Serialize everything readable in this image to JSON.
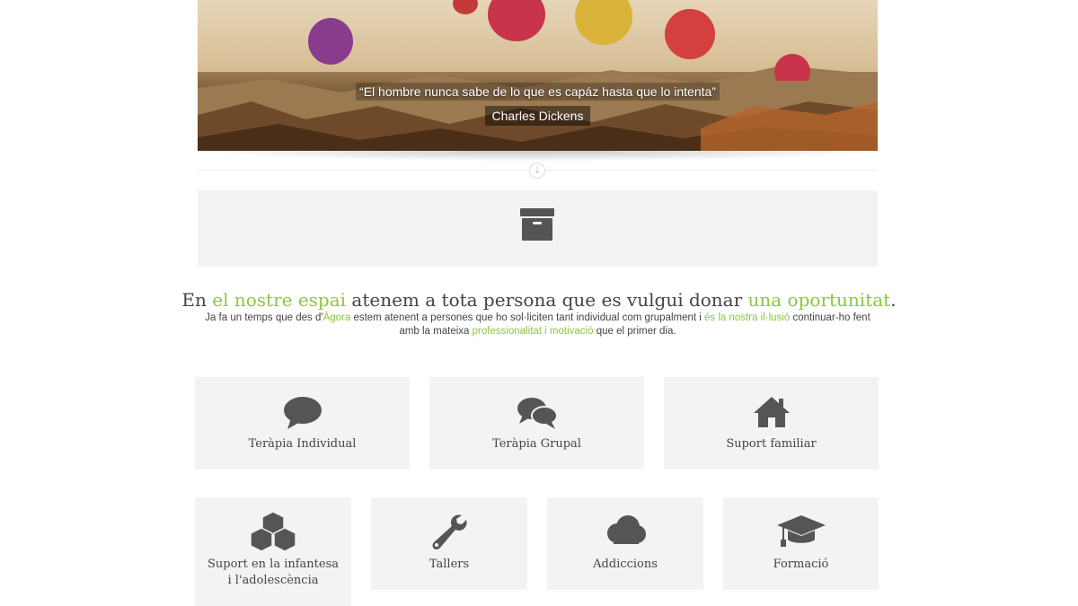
{
  "hero": {
    "quote": "“El hombre nunca sabe de lo que es capáz hasta que lo intenta”",
    "author": "Charles Dickens"
  },
  "intro": {
    "title_part1": "En ",
    "title_highlight1": "el nostre espai",
    "title_part2": " atenem a tota persona que es vulgui donar ",
    "title_highlight2": "una oportunitat",
    "title_part3": ".",
    "text_part1": "Ja fa un temps que des d'",
    "text_highlight1": "Àgora",
    "text_part2": " estem atenent a persones que ho sol·liciten tant individual com grupalment i ",
    "text_highlight2": "és la nostra il·lusió",
    "text_part3": " continuar-ho fent amb la mateixa ",
    "text_highlight3": "professionalitat i motivació",
    "text_part4": " que el primer dia."
  },
  "services_row1": [
    {
      "label": "Teràpia Individual",
      "icon": "speech-bubble-icon"
    },
    {
      "label": "Teràpia Grupal",
      "icon": "chat-bubbles-icon"
    },
    {
      "label": "Suport familiar",
      "icon": "home-icon"
    }
  ],
  "services_row2": [
    {
      "label": "Suport en la infantesa i l'adolescència",
      "icon": "cubes-icon"
    },
    {
      "label": "Tallers",
      "icon": "wrench-icon"
    },
    {
      "label": "Addiccions",
      "icon": "cloud-icon"
    },
    {
      "label": "Formació",
      "icon": "graduation-cap-icon"
    }
  ],
  "colors": {
    "accent": "#8cc63f",
    "card_bg": "#f3f3f3",
    "icon": "#555555"
  }
}
